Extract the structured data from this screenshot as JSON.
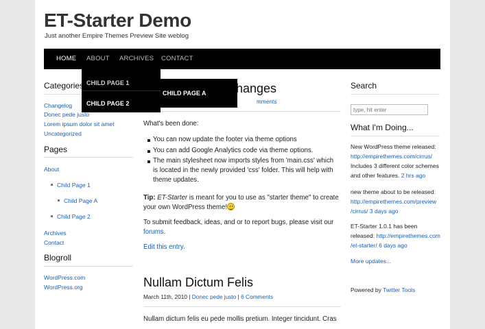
{
  "header": {
    "site_title": "ET-Starter Demo",
    "tagline": "Just another Empire Themes Preview Site weblog"
  },
  "nav": {
    "items": [
      "HOME",
      "ABOUT",
      "ARCHIVES",
      "CONTACT"
    ],
    "dropdown": [
      "CHILD PAGE 1",
      "CHILD PAGE 2"
    ],
    "subdropdown": [
      "CHILD PAGE A"
    ]
  },
  "left_sidebar": {
    "categories_heading": "Categories",
    "categories": [
      "Changelog",
      "Donec pede justo",
      "Lorem ipsum dolor sit amet",
      "Uncategorized"
    ],
    "pages_heading": "Pages",
    "pages": {
      "about": "About",
      "child1": "Child Page 1",
      "childA": "Child Page A",
      "child2": "Child Page 2",
      "archives": "Archives",
      "contact": "Contact"
    },
    "blogroll_heading": "Blogroll",
    "blogroll": [
      "WordPress.com",
      "WordPress.org"
    ]
  },
  "post1": {
    "title_visible": "hanges",
    "meta_visible": "mments",
    "intro": "What's been done:",
    "bullets": [
      "You can now update the footer via theme options",
      "You can add Google Analytics code via theme options.",
      "The main stylesheet now imports styles from 'main.css' which",
      "is located in the newly provided 'css' folder. This will help with",
      "theme updates."
    ],
    "tip_label": "Tip:",
    "tip_em": "ET-Starter",
    "tip_rest_1": " is meant for you to use as \"starter theme\" to create",
    "tip_rest_2": "your own WordPress theme!",
    "feedback_1": "To submit feedback, ideas, and or to report bugs, please visit our",
    "feedback_link": "forums",
    "feedback_end": ".",
    "edit_link": "Edit this entry."
  },
  "post2": {
    "title": "Nullam Dictum Felis",
    "date": "March 11th, 2010",
    "sep": "|",
    "category_link": "Donec pede justo",
    "comments_link": "6 Comments",
    "excerpt": "Nullam dictum felis eu pede mollis pretium. Integer tincidunt. Cras"
  },
  "right_sidebar": {
    "search_heading": "Search",
    "search_placeholder": "type, hit enter",
    "doing_heading": "What I'm Doing...",
    "tweets": [
      {
        "lines": [
          "New WordPress theme released:"
        ],
        "link_lines": [
          "http://empirethemes.com/cirrus/"
        ],
        "after_lines": [
          "Includes 3 different color schemes",
          "and other features."
        ],
        "time": "2 hrs ago"
      },
      {
        "lines": [
          "new theme about to be released:"
        ],
        "link_lines": [
          "http://empirethemes.com/preview",
          "/cirrus/"
        ],
        "time": "3 days ago"
      },
      {
        "lines": [
          "ET-Starter 1.0.1 has been",
          "released:"
        ],
        "link_lines": [
          "http://empirethemes.com",
          "/et-starter/"
        ],
        "time": "6 days ago"
      }
    ],
    "more_updates": "More updates...",
    "powered_by": "Powered by",
    "twitter_tools": "Twitter Tools"
  }
}
